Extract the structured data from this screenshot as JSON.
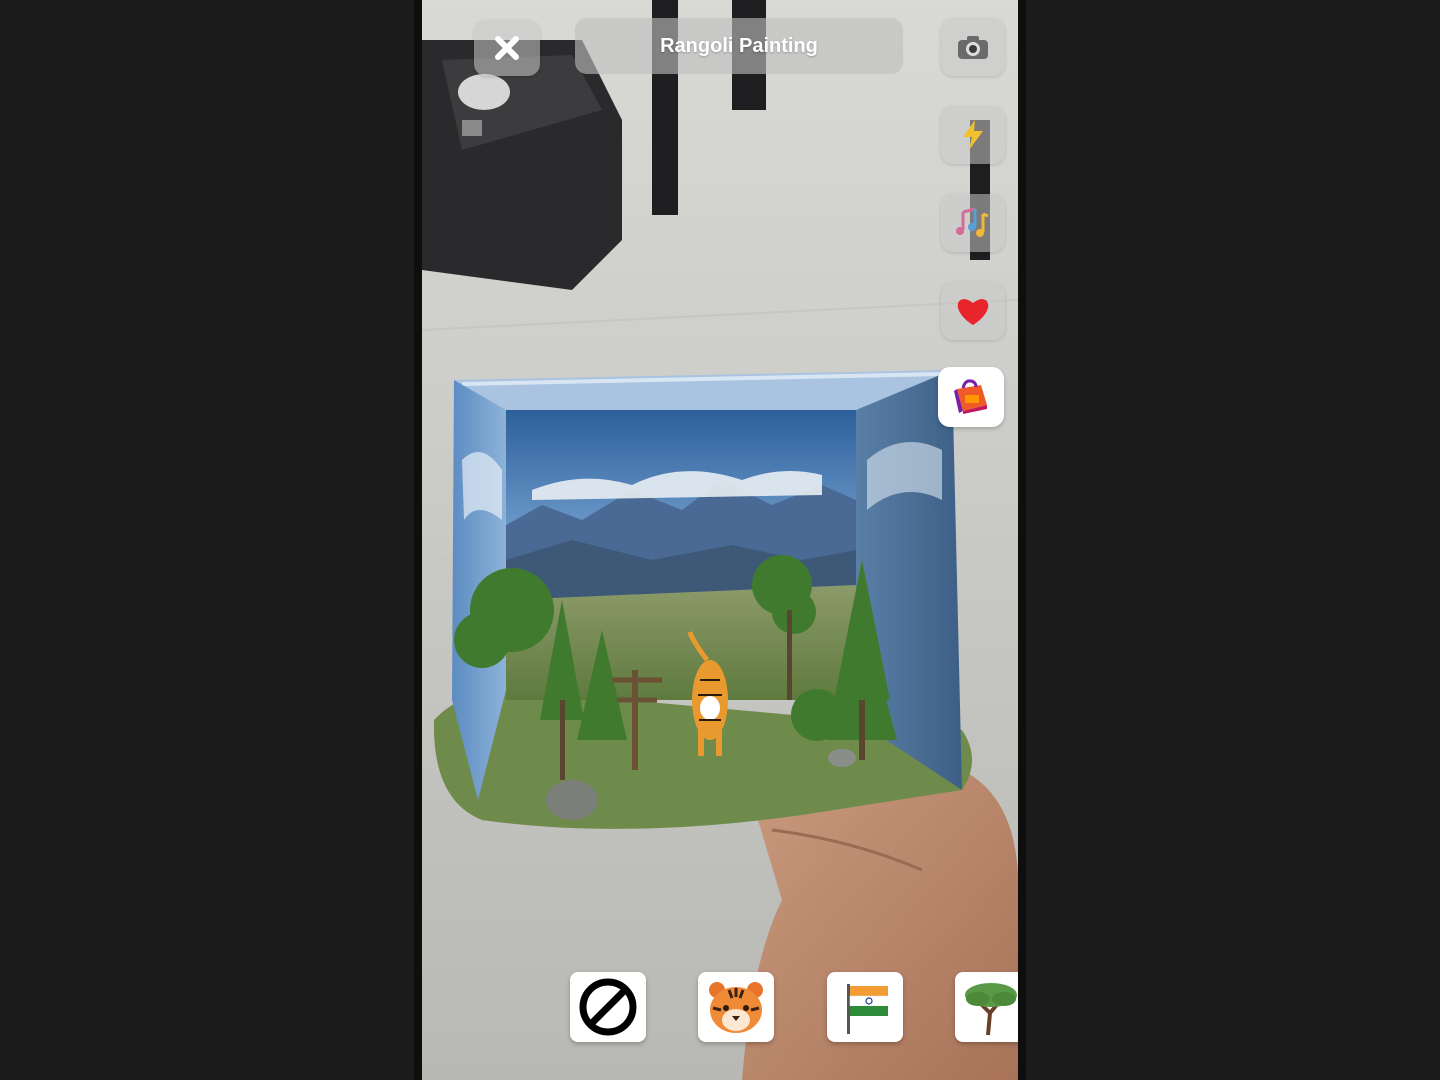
{
  "header": {
    "title": "Rangoli Painting",
    "close_icon": "close-icon",
    "camera_icon": "camera-icon"
  },
  "side_actions": [
    {
      "name": "flash-button",
      "icon": "lightning-icon"
    },
    {
      "name": "music-button",
      "icon": "music-notes-icon"
    },
    {
      "name": "favorite-button",
      "icon": "heart-icon"
    },
    {
      "name": "shop-button",
      "icon": "shopping-bag-icon"
    }
  ],
  "ar_scene": {
    "description_icons": [
      "diorama-forest",
      "tiger-model"
    ]
  },
  "stickers": [
    {
      "name": "sticker-none",
      "icon": "no-entry-icon"
    },
    {
      "name": "sticker-tiger",
      "icon": "tiger-face-icon"
    },
    {
      "name": "sticker-india-flag",
      "icon": "india-flag-icon"
    },
    {
      "name": "sticker-tree",
      "icon": "tree-icon"
    }
  ],
  "colors": {
    "heart": "#e8242d",
    "lightning": "#f2c12e",
    "sticker_bg": "#ffffff"
  }
}
